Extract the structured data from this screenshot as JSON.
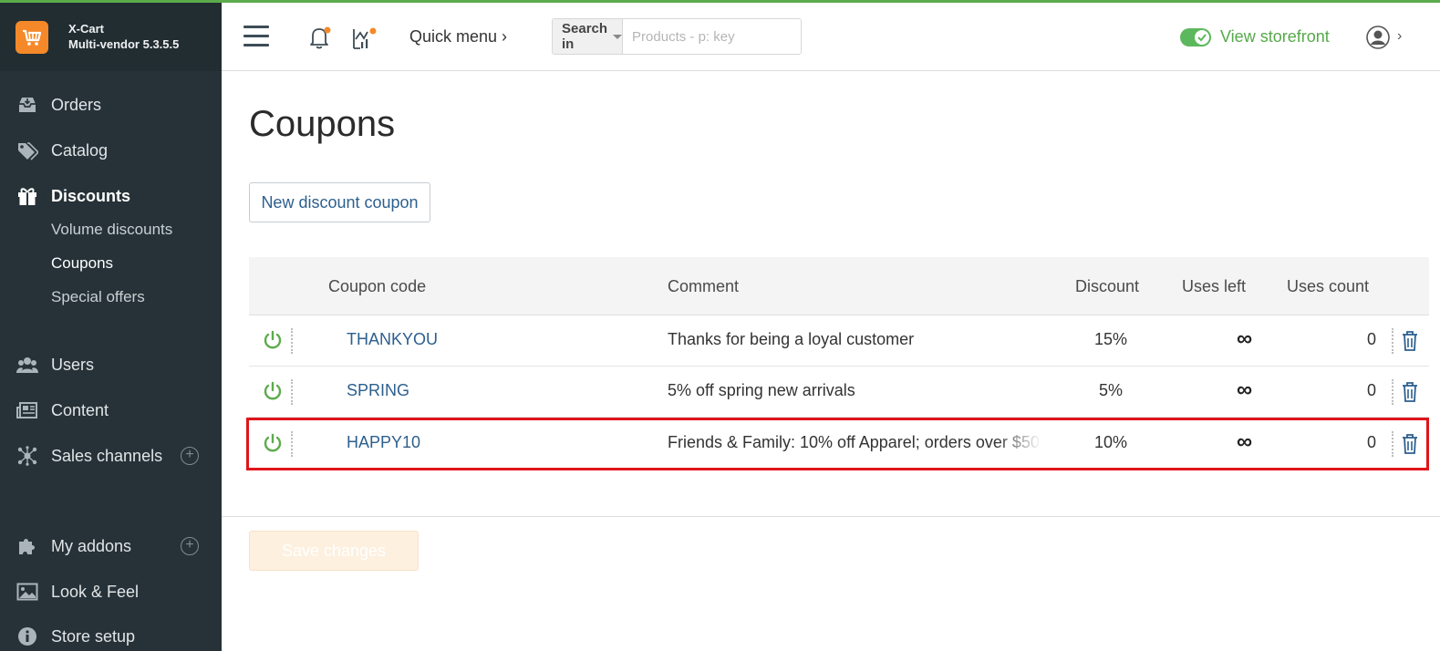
{
  "brand": {
    "name": "X-Cart",
    "version_line": "Multi-vendor 5.3.5.5"
  },
  "sidebar": {
    "items": [
      {
        "label": "Orders",
        "icon": "inbox-icon"
      },
      {
        "label": "Catalog",
        "icon": "tags-icon"
      },
      {
        "label": "Discounts",
        "icon": "gift-icon",
        "active": true
      },
      {
        "label": "Users",
        "icon": "users-icon"
      },
      {
        "label": "Content",
        "icon": "newspaper-icon"
      },
      {
        "label": "Sales channels",
        "icon": "network-icon"
      },
      {
        "label": "My addons",
        "icon": "puzzle-icon"
      },
      {
        "label": "Look & Feel",
        "icon": "image-icon"
      },
      {
        "label": "Store setup",
        "icon": "info-icon"
      }
    ],
    "discount_subitems": [
      {
        "label": "Volume discounts"
      },
      {
        "label": "Coupons",
        "active": true
      },
      {
        "label": "Special offers"
      }
    ],
    "plus_label": "+"
  },
  "header": {
    "quick_menu": "Quick menu ›",
    "search_in": "Search in",
    "search_placeholder": "Products - p: key",
    "view_storefront": "View storefront",
    "avatar_chevron": "›"
  },
  "page": {
    "title": "Coupons",
    "new_coupon_label": "New discount coupon",
    "save_label": "Save changes"
  },
  "table": {
    "columns": {
      "code": "Coupon code",
      "comment": "Comment",
      "discount": "Discount",
      "uses_left": "Uses left",
      "uses_count": "Uses count"
    },
    "rows": [
      {
        "code": "THANKYOU",
        "comment": "Thanks for being a loyal customer",
        "discount": "15%",
        "uses_left": "∞",
        "uses_count": "0"
      },
      {
        "code": "SPRING",
        "comment": "5% off spring new arrivals",
        "discount": "5%",
        "uses_left": "∞",
        "uses_count": "0"
      },
      {
        "code": "HAPPY10",
        "comment": "Friends & Family: 10% off Apparel; orders over $50",
        "discount": "10%",
        "uses_left": "∞",
        "uses_count": "0"
      }
    ]
  },
  "colors": {
    "sidebar_bg": "#263238",
    "accent_green": "#5cab4b",
    "link_blue": "#2d5f8e",
    "brand_orange": "#f5892a",
    "highlight_red": "#e0141b"
  }
}
